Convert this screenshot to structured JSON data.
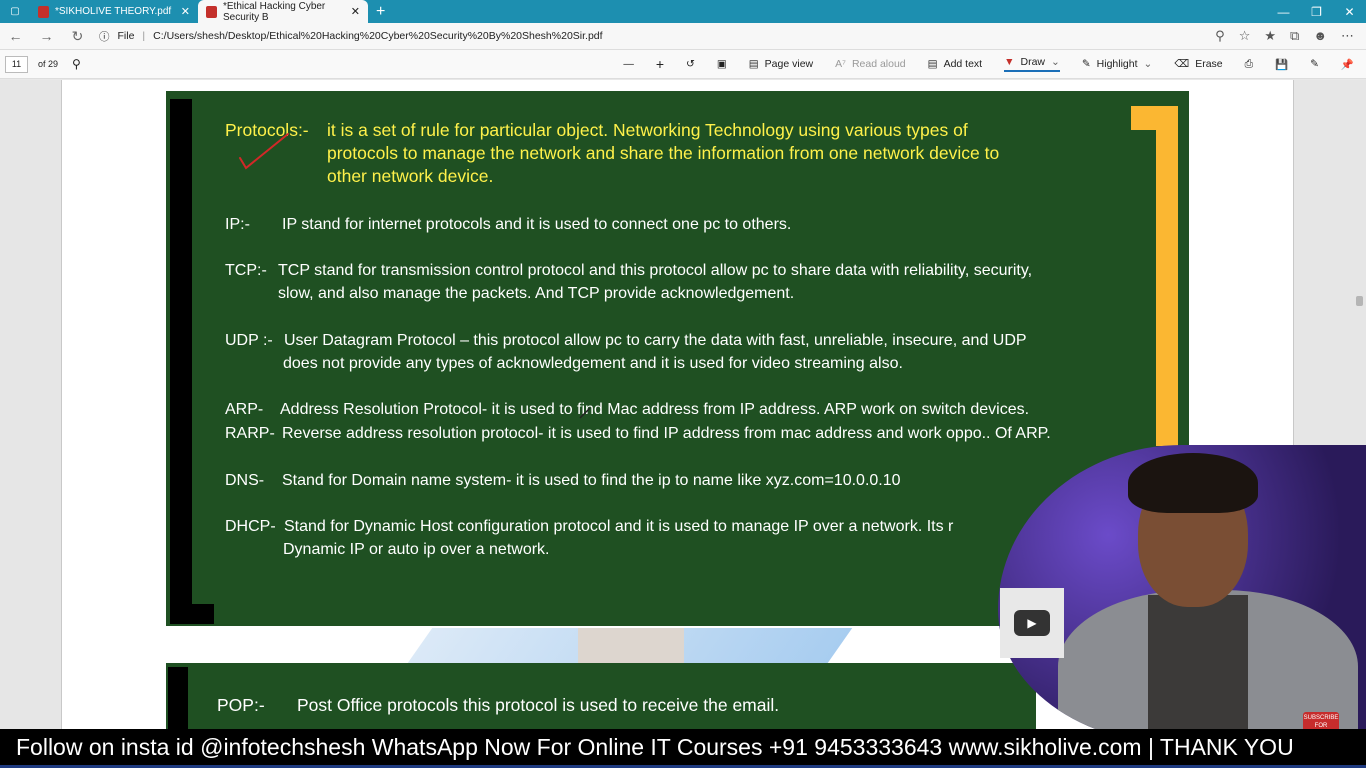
{
  "browser": {
    "tabs": [
      {
        "title": "*SIKHOLIVE THEORY.pdf",
        "active": false
      },
      {
        "title": "*Ethical Hacking Cyber Security B",
        "active": true
      }
    ],
    "address": {
      "scheme_label": "File",
      "url": "C:/Users/shesh/Desktop/Ethical%20Hacking%20Cyber%20Security%20By%20Shesh%20Sir.pdf"
    }
  },
  "pdf_toolbar": {
    "page_number": "11",
    "page_total": "of 29",
    "page_view": "Page view",
    "read_aloud": "Read aloud",
    "add_text": "Add text",
    "draw": "Draw",
    "highlight": "Highlight",
    "erase": "Erase"
  },
  "slide": {
    "protocols_label": "Protocols:-",
    "protocols_line1": "it is a set of rule for particular object.    Networking Technology using various types of",
    "protocols_line2": "protocols to manage the  network and share the information from one network device to",
    "protocols_line3": "other network device.",
    "items": [
      {
        "label": "IP:-",
        "line1": "IP stand for internet protocols and it is used to connect one pc to others.",
        "line2": ""
      },
      {
        "label": "TCP:-",
        "line1": "TCP stand for transmission control protocol and this protocol allow pc to share data with reliability, security,",
        "line2": "slow, and also manage the packets.  And TCP provide acknowledgement."
      },
      {
        "label": "UDP :-",
        "line1": "User Datagram Protocol – this protocol allow pc to carry the data with fast, unreliable, insecure, and  UDP",
        "line2": "does not provide any types of acknowledgement  and it is used for video streaming also."
      },
      {
        "label": "ARP-",
        "line1": "Address Resolution Protocol- it is used to find Mac address from IP address.  ARP work on switch devices.",
        "line2": ""
      },
      {
        "label": "RARP-",
        "line1": "Reverse address resolution protocol-  it is used to find IP address from mac address and work oppo.. Of ARP.",
        "line2": ""
      },
      {
        "label": "DNS-",
        "line1": "Stand for Domain name system-  it is used to find the ip to name like  xyz.com=10.0.0.10",
        "line2": ""
      },
      {
        "label": "DHCP-",
        "line1": "Stand for Dynamic Host configuration protocol and it is used to manage IP over a network. Its r",
        "line2": "Dynamic IP or auto ip over a network."
      }
    ]
  },
  "slide2": {
    "label": "POP:-",
    "text": "Post Office protocols this protocol is used to receive the email."
  },
  "overlay": {
    "subscribe_badge": "SUBSCRIBE FOR UPDATES"
  },
  "banner": {
    "text": "Follow on insta id @infotechshesh    WhatsApp Now For Online IT Courses +91 9453333643  www.sikholive.com | THANK YOU"
  },
  "colors": {
    "tabbar": "#1d8fb0",
    "slide_bg": "#1f5022",
    "slide_heading": "#fff14a",
    "accent_bar": "#fbb732",
    "annotation": "#d22828"
  }
}
